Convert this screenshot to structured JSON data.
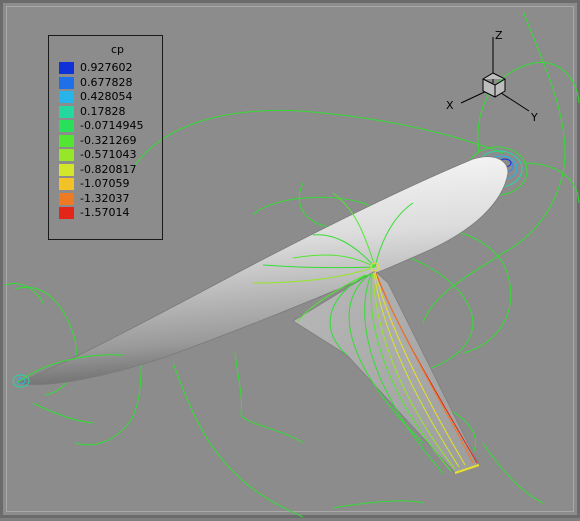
{
  "legend": {
    "title": "cp",
    "entries": [
      {
        "label": "0.927602",
        "color": "#1030d8"
      },
      {
        "label": "0.677828",
        "color": "#1e70e8"
      },
      {
        "label": "0.428054",
        "color": "#27b4ea"
      },
      {
        "label": "0.17828",
        "color": "#25d8a0"
      },
      {
        "label": "-0.0714945",
        "color": "#2ae05a"
      },
      {
        "label": "-0.321269",
        "color": "#52e632"
      },
      {
        "label": "-0.571043",
        "color": "#96e62a"
      },
      {
        "label": "-0.820817",
        "color": "#d2e62a"
      },
      {
        "label": "-1.07059",
        "color": "#f2c226"
      },
      {
        "label": "-1.32037",
        "color": "#ee7a22"
      },
      {
        "label": "-1.57014",
        "color": "#e42618"
      }
    ]
  },
  "axes": {
    "x_label": "X",
    "y_label": "Y",
    "z_label": "Z"
  },
  "colors": {
    "background": "#8c8c8c",
    "body_surface": "#e8e8e8",
    "contour_green": "#33dd33",
    "contour_yellow": "#e8e02a",
    "contour_orange": "#ee7a22",
    "contour_red": "#e42618",
    "contour_blue": "#2a8ae8"
  }
}
